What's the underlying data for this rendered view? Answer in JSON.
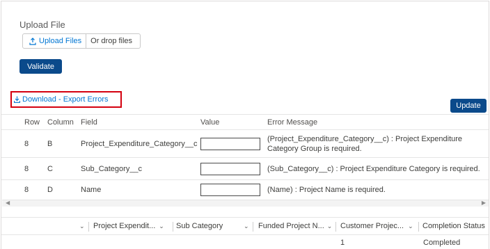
{
  "upload": {
    "label": "Upload File",
    "button_label": "Upload Files",
    "drop_text": "Or drop files"
  },
  "actions": {
    "validate_label": "Validate",
    "download_label": "Download - Export Errors",
    "update_label": "Update"
  },
  "errors_table": {
    "headers": {
      "row": "Row",
      "column": "Column",
      "field": "Field",
      "value": "Value",
      "message": "Error Message"
    },
    "rows": [
      {
        "row": "8",
        "column": "B",
        "field": "Project_Expenditure_Category__c",
        "value": "",
        "message": "(Project_Expenditure_Category__c) : Project Expenditure Category Group is required."
      },
      {
        "row": "8",
        "column": "C",
        "field": "Sub_Category__c",
        "value": "",
        "message": "(Sub_Category__c) : Project Expenditure Category is required."
      },
      {
        "row": "8",
        "column": "D",
        "field": "Name",
        "value": "",
        "message": "(Name) : Project Name is required."
      }
    ]
  },
  "grid": {
    "columns": [
      "Project Expendit...",
      "Sub Category",
      "Funded Project N...",
      "Customer Projec...",
      "Completion Status"
    ],
    "first_row": {
      "customer_project": "1",
      "completion_status": "Completed"
    }
  },
  "colors": {
    "primary": "#0b4a8b",
    "link": "#0176d3",
    "highlight_border": "#d4000f"
  }
}
